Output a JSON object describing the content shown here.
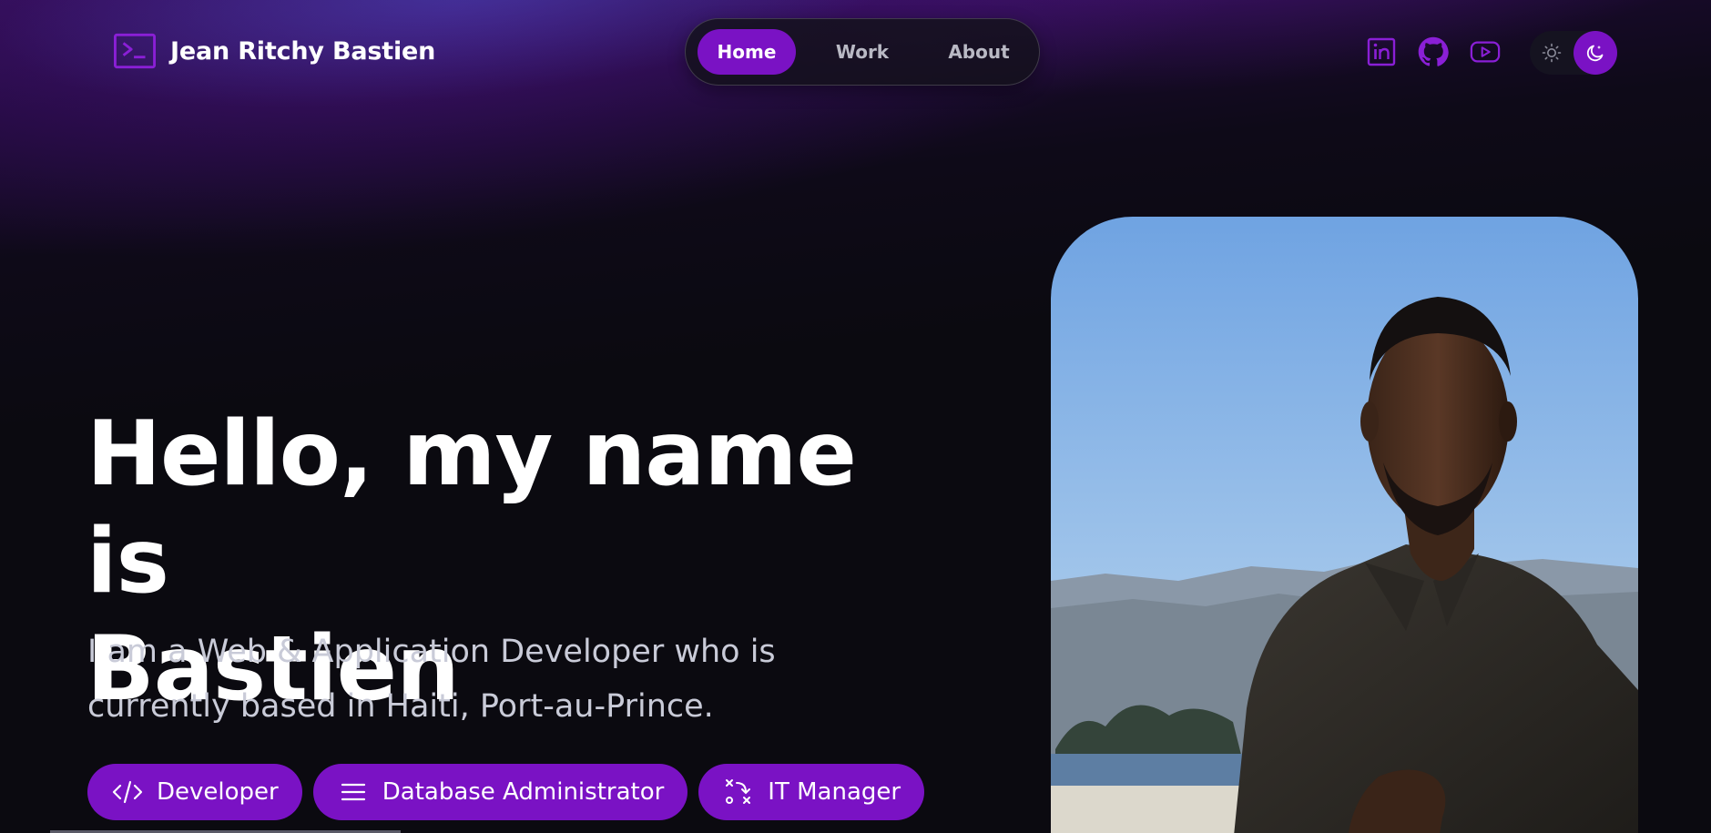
{
  "header": {
    "site_name": "Jean Ritchy Bastien",
    "logo_icon": "terminal-icon",
    "nav": [
      {
        "label": "Home",
        "active": true
      },
      {
        "label": "Work",
        "active": false
      },
      {
        "label": "About",
        "active": false
      }
    ],
    "socials": [
      {
        "icon": "linkedin-icon"
      },
      {
        "icon": "github-icon"
      },
      {
        "icon": "youtube-icon"
      }
    ],
    "theme_toggle": {
      "light_icon": "sun-icon",
      "dark_icon": "moon-icon",
      "selected": "dark"
    }
  },
  "hero": {
    "headline_line1": "Hello, my name is",
    "headline_line2": "Bastien",
    "subtitle_line1": "I am a Web & Application Developer who is",
    "subtitle_line2": "currently based in Haiti, Port-au-Prince.",
    "roles": [
      {
        "label": "Developer",
        "icon": "code-icon"
      },
      {
        "label": "Database Administrator",
        "icon": "menu-lines-icon"
      },
      {
        "label": "IT Manager",
        "icon": "strategy-icon"
      }
    ]
  },
  "colors": {
    "accent": "#7a12c4",
    "background": "#0b0a10",
    "text_primary": "#ffffff",
    "text_secondary": "#c9cbd8"
  }
}
